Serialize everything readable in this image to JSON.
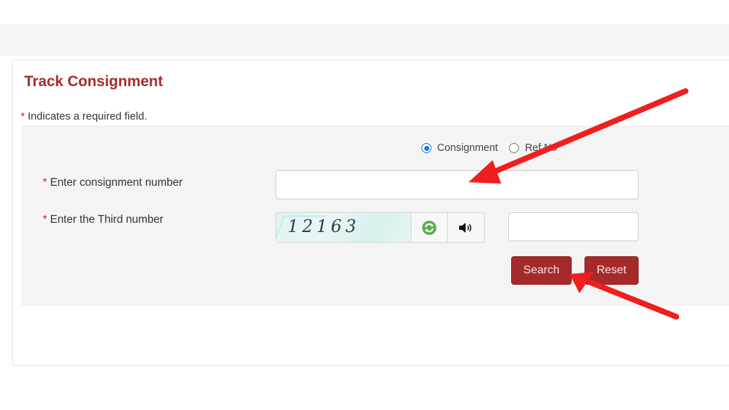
{
  "page": {
    "title": "Track Consignment",
    "required_note_star": "*",
    "required_note": " Indicates a required field."
  },
  "search_type": {
    "options": [
      {
        "label": "Consignment",
        "selected": true
      },
      {
        "label": "Ref No",
        "selected": false
      }
    ]
  },
  "fields": {
    "consignment": {
      "star": "*",
      "label": " Enter consignment number",
      "value": "",
      "placeholder": ""
    },
    "captcha": {
      "star": "*",
      "label": " Enter the Third number",
      "captcha_text": "12163",
      "value": "",
      "placeholder": ""
    }
  },
  "icons": {
    "refresh": "refresh-icon",
    "audio": "speaker-icon"
  },
  "buttons": {
    "search": "Search",
    "reset": "Reset"
  },
  "colors": {
    "brand": "#a52a2a",
    "annotation_arrow": "#f01e1e",
    "radio_selected": "#1a73e8"
  }
}
